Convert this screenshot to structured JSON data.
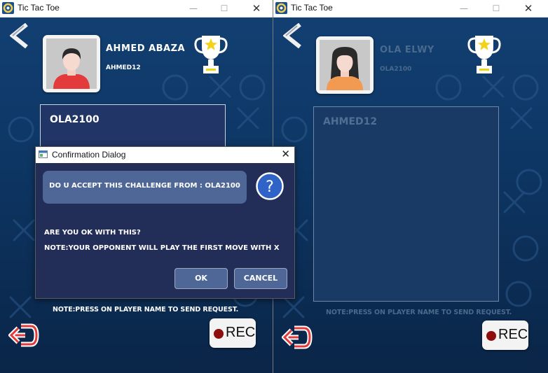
{
  "left_window": {
    "title": "Tic Tac Toe",
    "controls": {
      "minimize": "—",
      "maximize": "☐",
      "close": "✕"
    },
    "player": {
      "name": "AHMED ABAZA",
      "username": "AHMED12"
    },
    "online_players": [
      "OLA2100"
    ],
    "note": "NOTE:PRESS ON PLAYER NAME TO SEND REQUEST.",
    "rec_label": "REC"
  },
  "right_window": {
    "title": "Tic Tac Toe",
    "controls": {
      "minimize": "—",
      "maximize": "☐",
      "close": "✕"
    },
    "player": {
      "name": "OLA ELWY",
      "username": "OLA2100"
    },
    "online_players": [
      "AHMED12"
    ],
    "note": "NOTE:PRESS ON PLAYER NAME TO SEND REQUEST.",
    "rec_label": "REC"
  },
  "dialog": {
    "title": "Confirmation Dialog",
    "close": "✕",
    "question": "DO U ACCEPT THIS CHALLENGE FROM : OLA2100",
    "message_line1": "ARE YOU OK WITH THIS?",
    "message_line2": "NOTE:YOUR OPPONENT WILL PLAY THE FIRST MOVE WITH X",
    "ok_label": "OK",
    "cancel_label": "CANCEL"
  },
  "colors": {
    "background_top": "#123f72",
    "background_bottom": "#0a2547",
    "panel": "#213566",
    "dialog": "#222d58",
    "button": "#4e6796",
    "rec_dot": "#8e0d0d",
    "trophy_gold": "#f3d21a"
  },
  "icons": [
    "app-icon",
    "back-icon",
    "trophy-icon",
    "exit-icon",
    "rec-icon",
    "question-icon",
    "dialog-app-icon"
  ]
}
